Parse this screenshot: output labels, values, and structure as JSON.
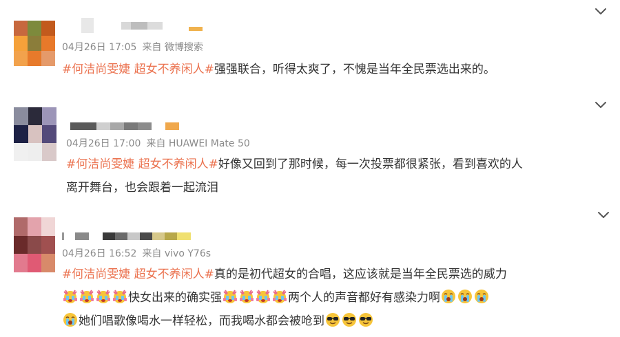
{
  "posts": [
    {
      "meta": {
        "date": "04月26日 17:05",
        "source": "来自 微博搜索"
      },
      "tag1": "#何洁尚雯婕 超女不养闲人#",
      "line1_text": "强强联合，听得太爽了，不愧是当年全民票选出来的。"
    },
    {
      "meta": {
        "date": "04月26日 17:00",
        "source": "来自 HUAWEI Mate 50"
      },
      "tag1": "#何洁尚雯婕 超女不养闲人#",
      "line1_text": "好像又回到了那时候，每一次投票都很紧张，看到喜欢的人",
      "line2_text": "离开舞台，也会跟着一起流泪"
    },
    {
      "meta": {
        "date": "04月26日 16:52",
        "source": "来自 vivo Y76s"
      },
      "tag1": "#何洁尚雯婕 超女不养闲人#",
      "line1_text": "真的是初代超女的合唱，这应该就是当年全民票选的威力",
      "line2_text": "快女出来的确实强",
      "line2_text_b": "两个人的声音都好有感染力啊",
      "line3_text": "她们唱歌像喝水一样轻松，而我喝水都会被呛到"
    }
  ],
  "icons": {
    "expand": "chevron-down-icon",
    "emoji_cry_cheer": "cry-cheer-emoji-icon",
    "emoji_cry": "crying-emoji-icon",
    "emoji_cool": "sunglasses-emoji-icon"
  },
  "colors": {
    "topic": "#eb7350",
    "meta": "#8a8a8a",
    "text": "#333333"
  }
}
